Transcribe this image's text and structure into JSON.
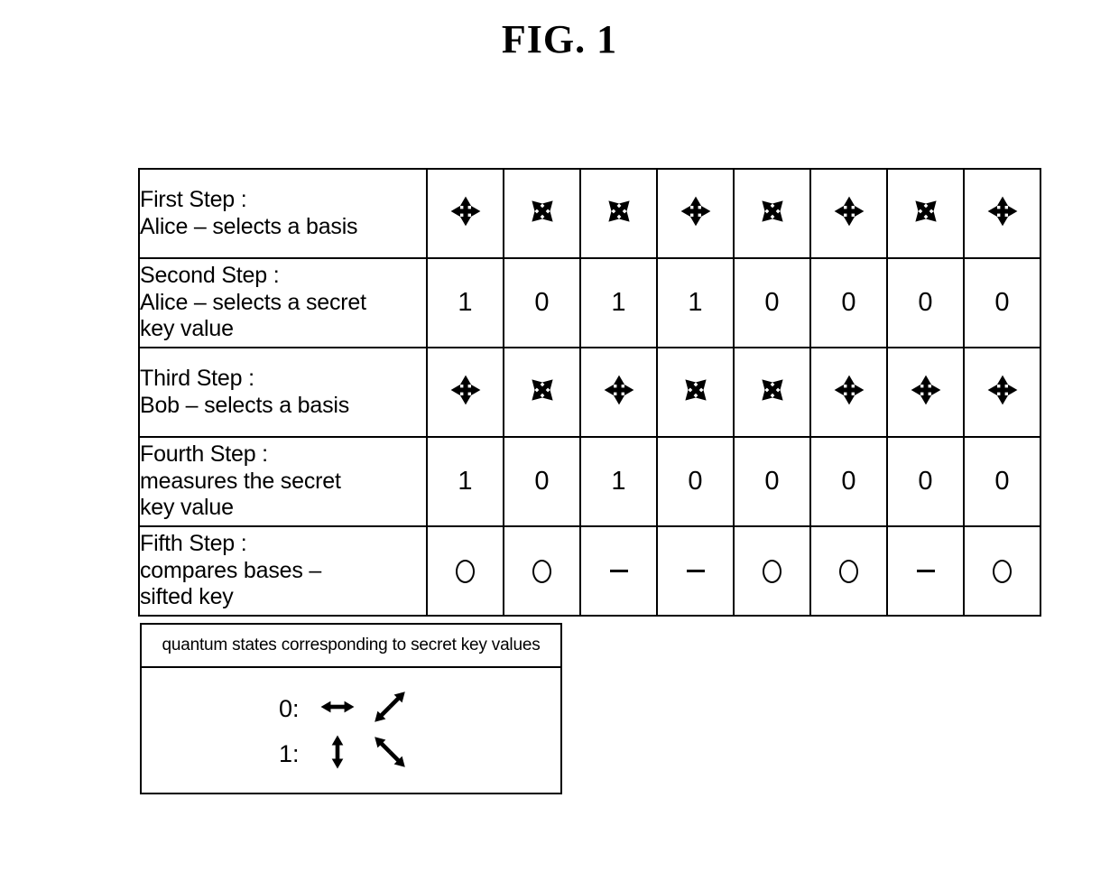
{
  "figure": {
    "title": "FIG. 1"
  },
  "table": {
    "rows": [
      {
        "id": "first-step",
        "label": "First Step :\nAlice – selects a basis",
        "type": "basis",
        "cells": [
          "rectilinear",
          "diagonal",
          "diagonal",
          "rectilinear",
          "diagonal",
          "rectilinear",
          "diagonal",
          "rectilinear"
        ]
      },
      {
        "id": "second-step",
        "label": "Second Step :\nAlice – selects a secret\n        key value",
        "type": "bits",
        "cells": [
          "1",
          "0",
          "1",
          "1",
          "0",
          "0",
          "0",
          "0"
        ]
      },
      {
        "id": "third-step",
        "label": "Third Step :\n Bob – selects a basis",
        "type": "basis",
        "cells": [
          "rectilinear",
          "diagonal",
          "rectilinear",
          "diagonal",
          "diagonal",
          "rectilinear",
          "rectilinear",
          "rectilinear"
        ]
      },
      {
        "id": "fourth-step",
        "label": "Fourth Step :\nmeasures the secret\nkey value",
        "type": "bits",
        "cells": [
          "1",
          "0",
          "1",
          "0",
          "0",
          "0",
          "0",
          "0"
        ]
      },
      {
        "id": "fifth-step",
        "label": "Fifth Step :\ncompares bases –\nsifted key",
        "type": "marks",
        "cells": [
          "circle",
          "circle",
          "dash",
          "dash",
          "circle",
          "circle",
          "dash",
          "circle"
        ]
      }
    ]
  },
  "legend": {
    "title": "quantum states corresponding to secret key values",
    "entries": [
      {
        "key": "0:",
        "states": [
          "horizontal",
          "diagonal-up"
        ]
      },
      {
        "key": "1:",
        "states": [
          "vertical",
          "diagonal-down"
        ]
      }
    ]
  },
  "colors": {
    "ink": "#000000",
    "paper": "#ffffff"
  }
}
